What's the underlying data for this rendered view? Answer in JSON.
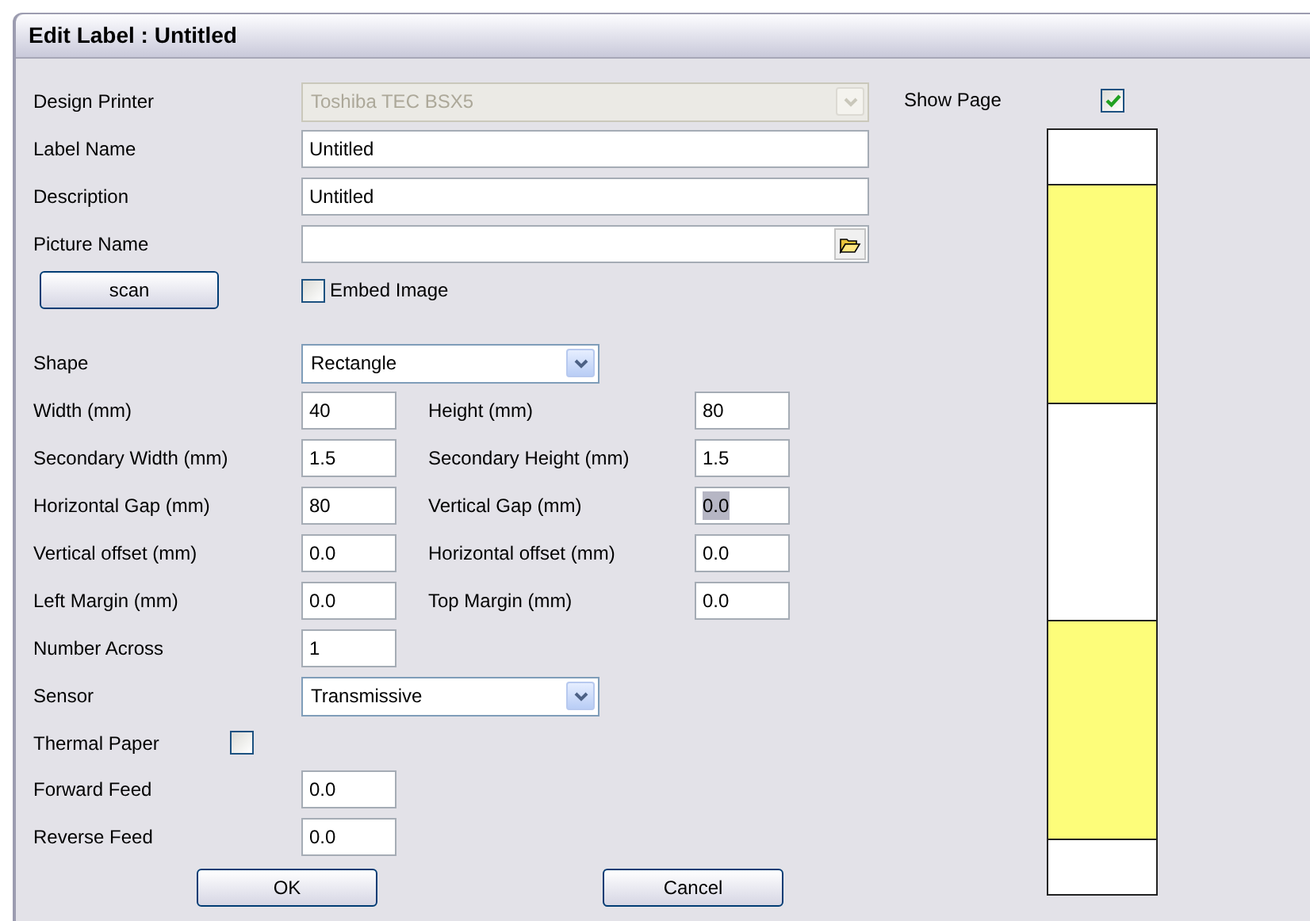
{
  "window": {
    "title": "Edit Label : Untitled"
  },
  "design_printer": {
    "label": "Design Printer",
    "value": "Toshiba TEC BSX5",
    "disabled": true
  },
  "label_name": {
    "label": "Label Name",
    "value": "Untitled"
  },
  "description": {
    "label": "Description",
    "value": "Untitled"
  },
  "picture_name": {
    "label": "Picture Name"
  },
  "scan_button": "scan",
  "embed_image": {
    "label": "Embed Image",
    "checked": false
  },
  "shape": {
    "label": "Shape",
    "value": "Rectangle"
  },
  "dimension_rows": [
    {
      "left": {
        "label": "Width (mm)",
        "value": "40",
        "focused": false
      },
      "right": {
        "label": "Height (mm)",
        "value": "80",
        "focused": false
      }
    },
    {
      "left": {
        "label": "Secondary Width (mm)",
        "value": "1.5",
        "focused": false
      },
      "right": {
        "label": "Secondary Height (mm)",
        "value": "1.5",
        "focused": false
      }
    },
    {
      "left": {
        "label": "Horizontal Gap (mm)",
        "value": "80",
        "focused": false
      },
      "right": {
        "label": "Vertical Gap (mm)",
        "value": "0.0",
        "focused": true
      }
    },
    {
      "left": {
        "label": "Vertical offset (mm)",
        "value": "0.0",
        "focused": false
      },
      "right": {
        "label": "Horizontal offset (mm)",
        "value": "0.0",
        "focused": false
      }
    },
    {
      "left": {
        "label": "Left Margin (mm)",
        "value": "0.0",
        "focused": false
      },
      "right": {
        "label": "Top Margin (mm)",
        "value": "0.0",
        "focused": false
      }
    },
    {
      "left": {
        "label": "Number Across",
        "value": "1",
        "focused": false
      }
    }
  ],
  "sensor": {
    "label": "Sensor",
    "value": "Transmissive"
  },
  "thermal_paper": {
    "label": "Thermal Paper",
    "checked": false
  },
  "forward_feed": {
    "label": "Forward Feed",
    "value": "0.0"
  },
  "reverse_feed": {
    "label": "Reverse Feed",
    "value": "0.0"
  },
  "buttons": [
    "OK",
    "Cancel"
  ],
  "show_page": {
    "label": "Show Page",
    "checked": true
  },
  "preview_segments": [
    {
      "kind": "edge"
    },
    {
      "kind": "label"
    },
    {
      "kind": "gap"
    },
    {
      "kind": "label"
    },
    {
      "kind": "edge"
    }
  ]
}
